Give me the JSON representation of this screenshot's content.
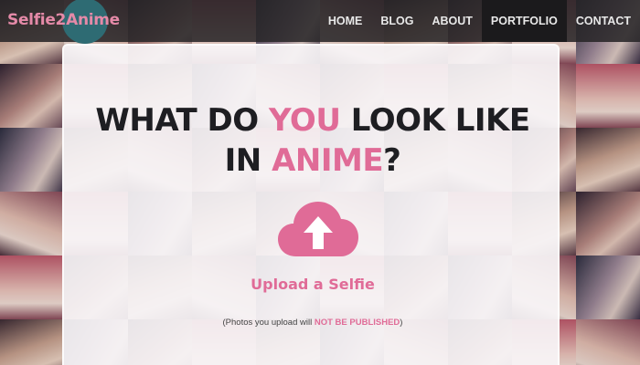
{
  "brand": {
    "logo_text": "Selfie2Anime"
  },
  "nav": {
    "items": [
      {
        "label": "HOME"
      },
      {
        "label": "BLOG"
      },
      {
        "label": "ABOUT"
      },
      {
        "label": "PORTFOLIO"
      },
      {
        "label": "CONTACT"
      }
    ],
    "active": "PORTFOLIO"
  },
  "hero": {
    "line1_a": "WHAT DO ",
    "line1_highlight": "YOU",
    "line1_b": " LOOK LIKE",
    "line2_a": "IN ",
    "line2_highlight": "ANIME",
    "line2_b": "?"
  },
  "upload": {
    "icon": "cloud-upload-icon",
    "label": "Upload a Selfie"
  },
  "note": {
    "prefix": "(Photos you upload will ",
    "emphasis": "NOT BE PUBLISHED",
    "suffix": ")"
  },
  "colors": {
    "accent_pink": "#e06b97",
    "header_bg": "#282628",
    "logo_circle": "#2e6b73"
  }
}
